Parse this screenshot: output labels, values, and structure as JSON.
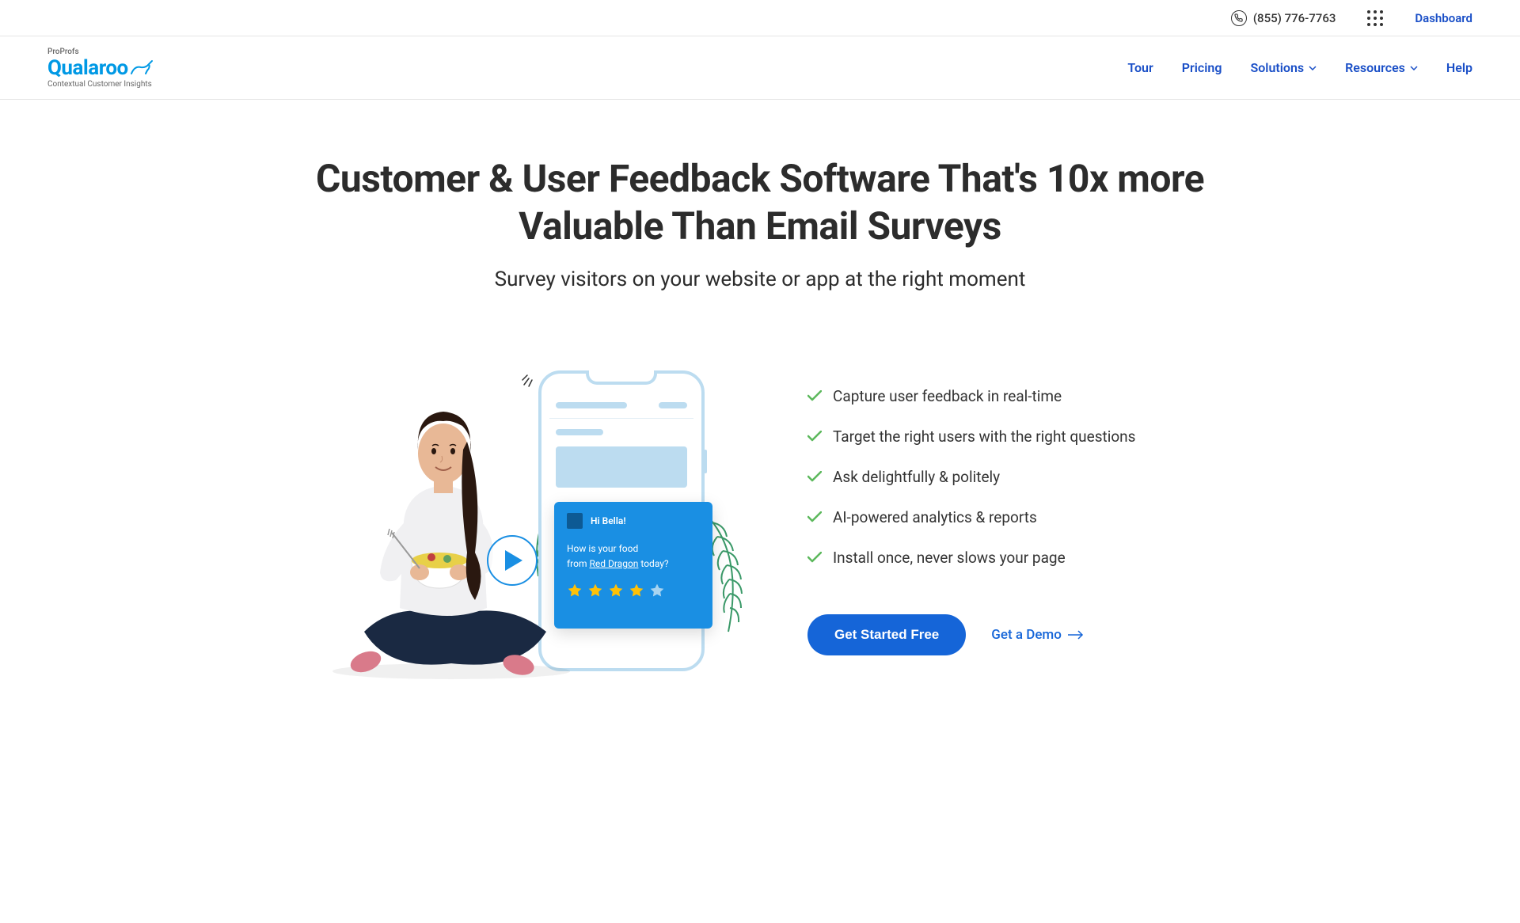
{
  "topbar": {
    "phone": "(855) 776-7763",
    "dashboard": "Dashboard"
  },
  "logo": {
    "pre": "ProProfs",
    "main": "Qualaroo",
    "sub": "Contextual Customer Insights"
  },
  "nav": {
    "tour": "Tour",
    "pricing": "Pricing",
    "solutions": "Solutions",
    "resources": "Resources",
    "help": "Help"
  },
  "hero": {
    "title": "Customer & User Feedback Software That's 10x more Valuable Than Email Surveys",
    "subtitle": "Survey visitors on your website or app at the right moment"
  },
  "survey": {
    "greeting": "Hi Bella!",
    "question_line1": "How is your food",
    "question_line2_pre": "from ",
    "question_line2_highlight": "Red Dragon",
    "question_line2_post": " today?"
  },
  "features": {
    "items": [
      "Capture user feedback in real-time",
      "Target the right users with the right questions",
      "Ask delightfully & politely",
      "AI-powered analytics & reports",
      "Install once, never slows your page"
    ]
  },
  "cta": {
    "primary": "Get Started Free",
    "secondary": "Get a Demo"
  }
}
